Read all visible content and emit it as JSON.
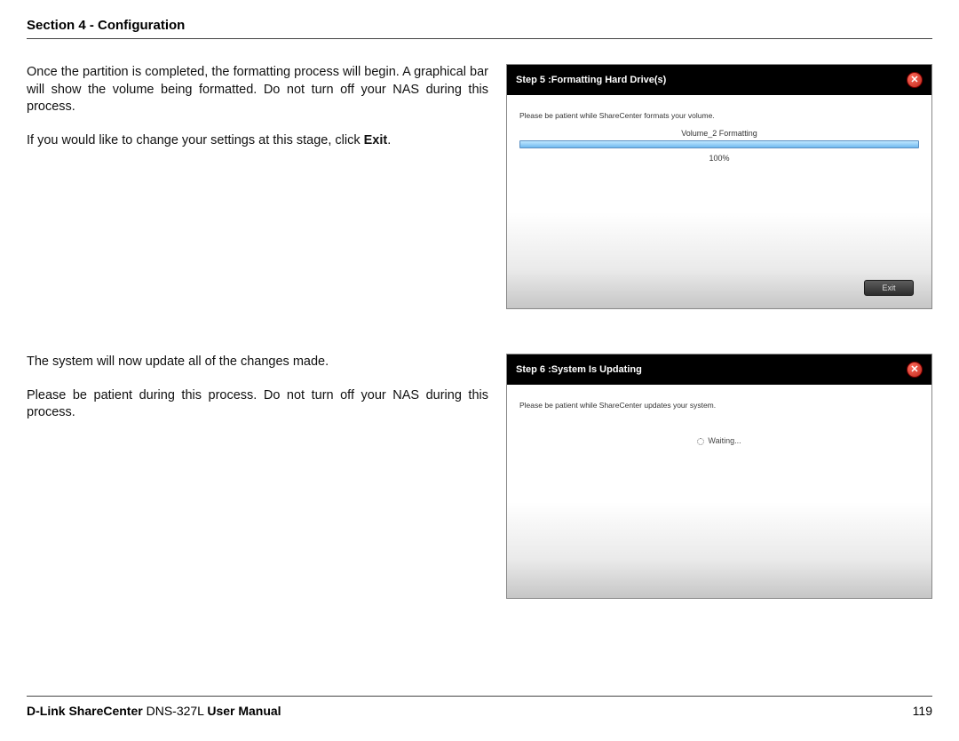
{
  "header": {
    "section_label": "Section 4 - Configuration"
  },
  "block1": {
    "para1": "Once the partition is completed, the formatting process will begin. A graphical bar will show the volume being formatted. Do not turn off your NAS during this process.",
    "para2_prefix": "If you would like to change your settings at this stage, click ",
    "para2_bold": "Exit",
    "para2_suffix": "."
  },
  "ss1": {
    "title": "Step 5 :Formatting Hard Drive(s)",
    "instruction": "Please be patient while ShareCenter formats your volume.",
    "volume_label": "Volume_2 Formatting",
    "percent": "100%",
    "exit_label": "Exit"
  },
  "block2": {
    "para1": "The system will now update all of the changes made.",
    "para2": "Please be patient during this process. Do not turn off your NAS during this process."
  },
  "ss2": {
    "title": "Step 6 :System Is Updating",
    "instruction": "Please be patient while ShareCenter updates your system.",
    "waiting": "Waiting..."
  },
  "footer": {
    "brand_bold1": "D-Link ShareCenter",
    "model": " DNS-327L ",
    "brand_bold2": "User Manual",
    "page": "119"
  }
}
